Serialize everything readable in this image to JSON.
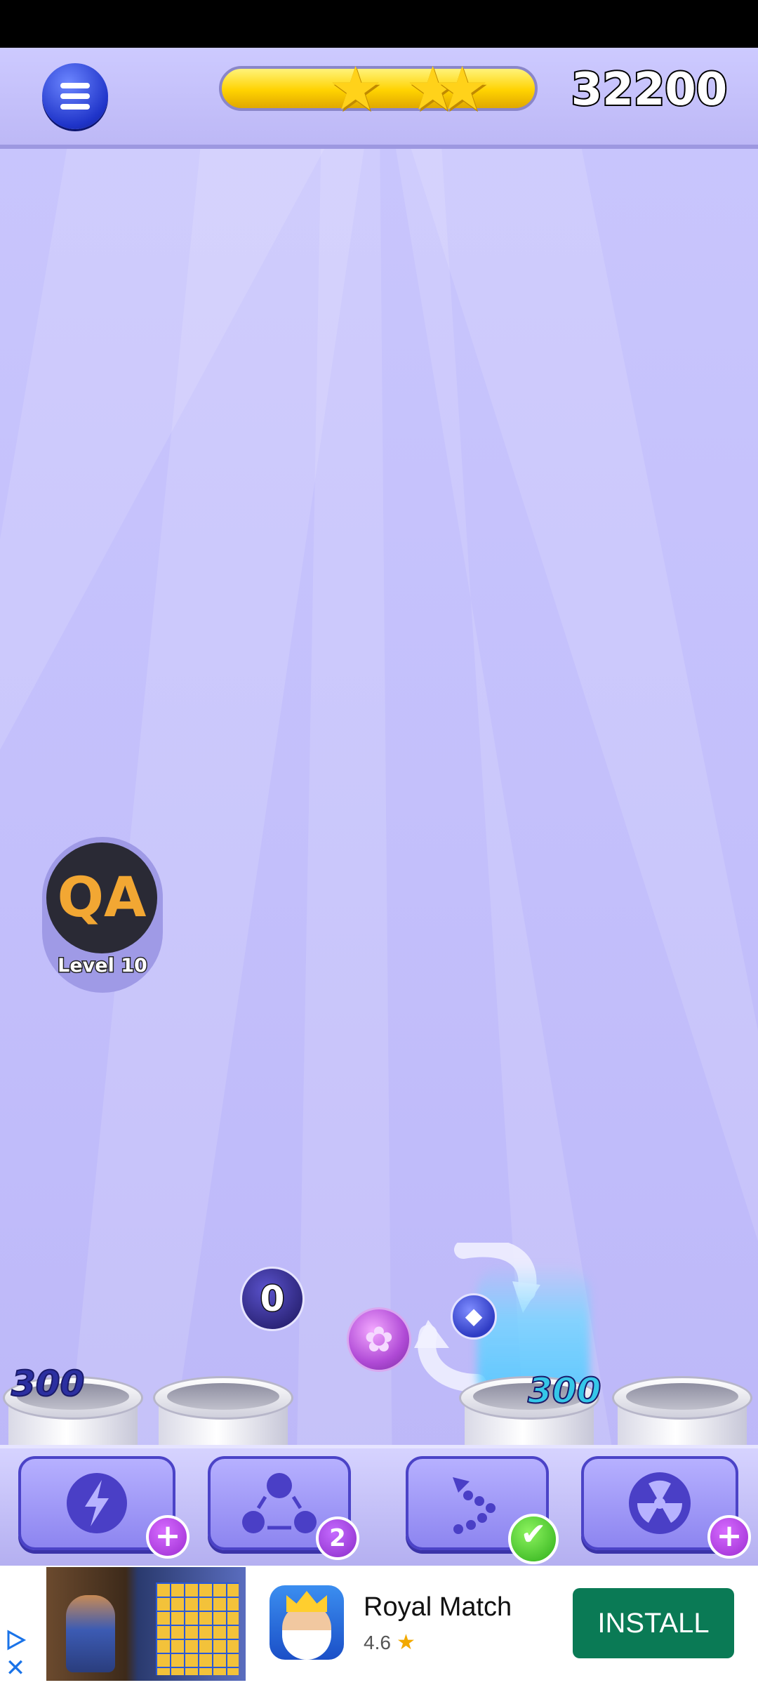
{
  "hud": {
    "score": "32200",
    "stars_earned": 3,
    "stars_total": 3,
    "progress": 1.0
  },
  "player": {
    "initials": "QA",
    "level_label": "Level 10"
  },
  "board": {
    "ball_zero_label": "0",
    "tube_scores": [
      "300",
      "300"
    ]
  },
  "boosters": [
    {
      "name": "lightning",
      "badge": "+"
    },
    {
      "name": "swap",
      "badge": "2"
    },
    {
      "name": "path",
      "badge": "✔"
    },
    {
      "name": "nuke",
      "badge": "+"
    }
  ],
  "ad": {
    "title": "Royal Match",
    "rating": "4.6",
    "star": "★",
    "install_label": "INSTALL",
    "close_glyph": "✕"
  },
  "colors": {
    "background": "#c3c0fb",
    "install_button": "#0a7a55",
    "menu_button": "#1f34c9",
    "progress_fill": "#ffd200"
  }
}
